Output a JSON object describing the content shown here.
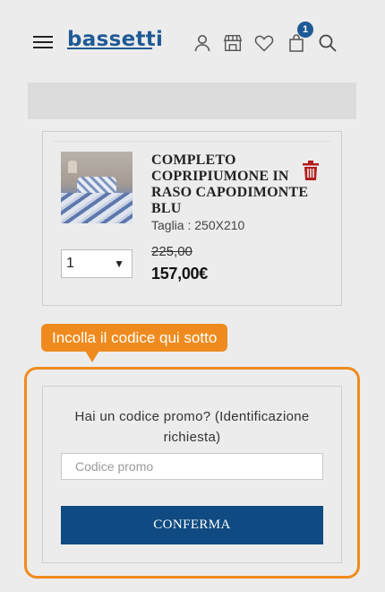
{
  "header": {
    "logo": "bassetti",
    "cart_count": "1",
    "icons": [
      "menu-icon",
      "user-icon",
      "store-icon",
      "heart-icon",
      "bag-icon",
      "search-icon"
    ]
  },
  "cart_item": {
    "name": "COMPLETO COPRIPIUMONE IN RASO CAPODIMONTE BLU",
    "size": "Taglia : 250X210",
    "quantity": "1",
    "old_price": "225,00",
    "new_price": "157,00€"
  },
  "callout": {
    "text": "Incolla il codice qui sotto"
  },
  "promo": {
    "question": "Hai un codice promo? (Identificazione richiesta)",
    "placeholder": "Codice promo",
    "confirm_label": "CONFERMA"
  },
  "colors": {
    "brand": "#1f5a96",
    "button": "#0f4a82",
    "accent": "#ef8b1e",
    "delete": "#b21d1d"
  }
}
